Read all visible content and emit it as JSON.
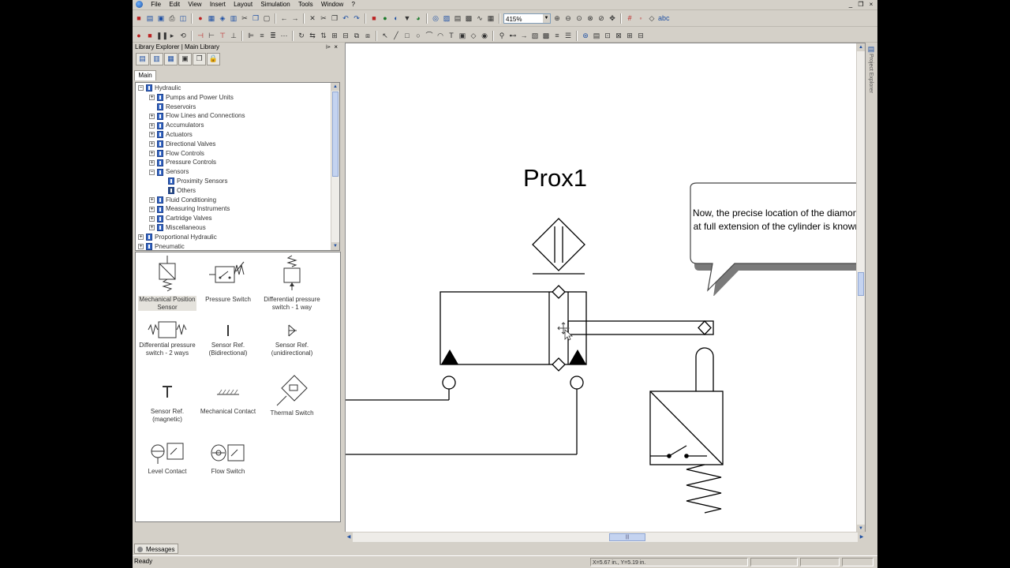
{
  "menu": [
    "File",
    "Edit",
    "View",
    "Insert",
    "Layout",
    "Simulation",
    "Tools",
    "Window",
    "?"
  ],
  "window_controls": [
    "_",
    "❐",
    "×"
  ],
  "toolbar": {
    "zoom_value": "415%"
  },
  "library": {
    "header": "Library Explorer | Main Library",
    "pin": "⌲",
    "close": "×",
    "tab": "Main",
    "tree": [
      {
        "label": "Hydraulic",
        "level": 0,
        "exp": "-"
      },
      {
        "label": "Pumps and Power Units",
        "level": 1,
        "exp": "+"
      },
      {
        "label": "Reservoirs",
        "level": 1,
        "exp": ""
      },
      {
        "label": "Flow Lines and Connections",
        "level": 1,
        "exp": "+"
      },
      {
        "label": "Accumulators",
        "level": 1,
        "exp": "+"
      },
      {
        "label": "Actuators",
        "level": 1,
        "exp": "+"
      },
      {
        "label": "Directional Valves",
        "level": 1,
        "exp": "+"
      },
      {
        "label": "Flow Controls",
        "level": 1,
        "exp": "+"
      },
      {
        "label": "Pressure Controls",
        "level": 1,
        "exp": "+"
      },
      {
        "label": "Sensors",
        "level": 1,
        "exp": "-"
      },
      {
        "label": "Proximity Sensors",
        "level": 2,
        "exp": ""
      },
      {
        "label": "Others",
        "level": 2,
        "exp": ""
      },
      {
        "label": "Fluid Conditioning",
        "level": 1,
        "exp": "+"
      },
      {
        "label": "Measuring Instruments",
        "level": 1,
        "exp": "+"
      },
      {
        "label": "Cartridge Valves",
        "level": 1,
        "exp": "+"
      },
      {
        "label": "Miscellaneous",
        "level": 1,
        "exp": "+"
      },
      {
        "label": "Proportional Hydraulic",
        "level": 0,
        "exp": "+"
      },
      {
        "label": "Pneumatic",
        "level": 0,
        "exp": "+"
      }
    ],
    "gallery": {
      "mech_pos": "Mechanical Position Sensor",
      "pressure_switch": "Pressure Switch",
      "diff_1way": "Differential pressure switch - 1 way",
      "diff_2way": "Differential pressure switch - 2 ways",
      "sensor_bi": "Sensor Ref. (Bidirectional)",
      "sensor_uni": "Sensor Ref. (unidirectional)",
      "sensor_mag": "Sensor Ref. (magnetic)",
      "mech_contact": "Mechanical Contact",
      "thermal": "Thermal Switch",
      "level": "Level Contact",
      "flow": "Flow Switch"
    }
  },
  "canvas": {
    "prox_label": "Prox1",
    "callout_text": "Now, the precise location of the diamond at full extension of the cylinder is known."
  },
  "project_explorer": "Project Explorer",
  "messages_tab": "Messages",
  "status": {
    "text": "Ready",
    "coords": "X=5.67 in., Y=5.19 in."
  }
}
